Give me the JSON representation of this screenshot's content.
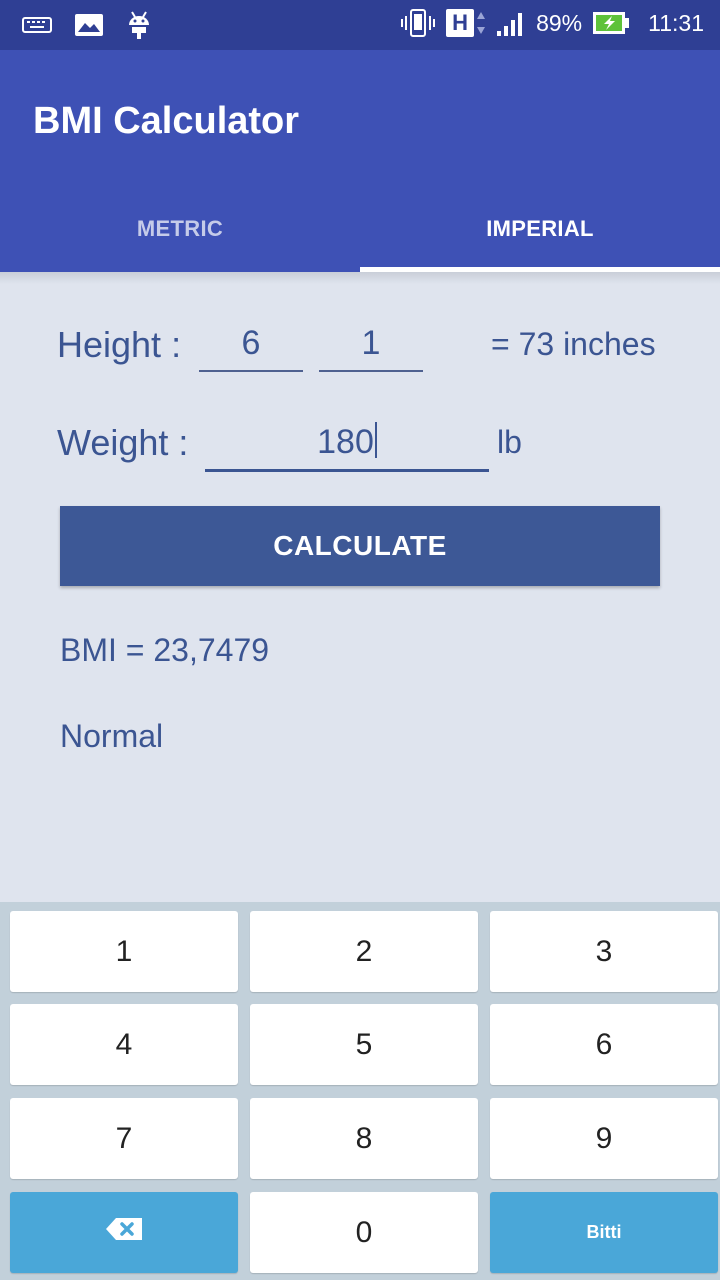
{
  "status_bar": {
    "network_type": "H",
    "battery_percent": "89%",
    "time": "11:31",
    "icons": [
      "keyboard-icon",
      "image-icon",
      "android-icon",
      "vibrate-icon",
      "network-h-icon",
      "signal-icon",
      "battery-charging-icon"
    ]
  },
  "app": {
    "title": "BMI Calculator",
    "colors": {
      "primary": "#3e51b5",
      "primary_dark": "#2f3f94",
      "accent_text": "#3b5592",
      "button": "#3d5896",
      "key_action": "#4aa7d8"
    }
  },
  "tabs": {
    "metric": "METRIC",
    "imperial": "IMPERIAL",
    "active": "IMPERIAL"
  },
  "form": {
    "height_label": "Height :",
    "height_feet": "6",
    "height_inches": "1",
    "height_conversion": "= 73 inches",
    "weight_label": "Weight :",
    "weight_value": "180",
    "weight_unit": "lb"
  },
  "calculate_label": "CALCULATE",
  "result": {
    "bmi_text": "BMI = 23,7479",
    "category": "Normal"
  },
  "keyboard": {
    "keys": [
      "1",
      "2",
      "3",
      "4",
      "5",
      "6",
      "7",
      "8",
      "9",
      "0"
    ],
    "done_label": "Bitti",
    "backspace_icon": "backspace-icon"
  }
}
